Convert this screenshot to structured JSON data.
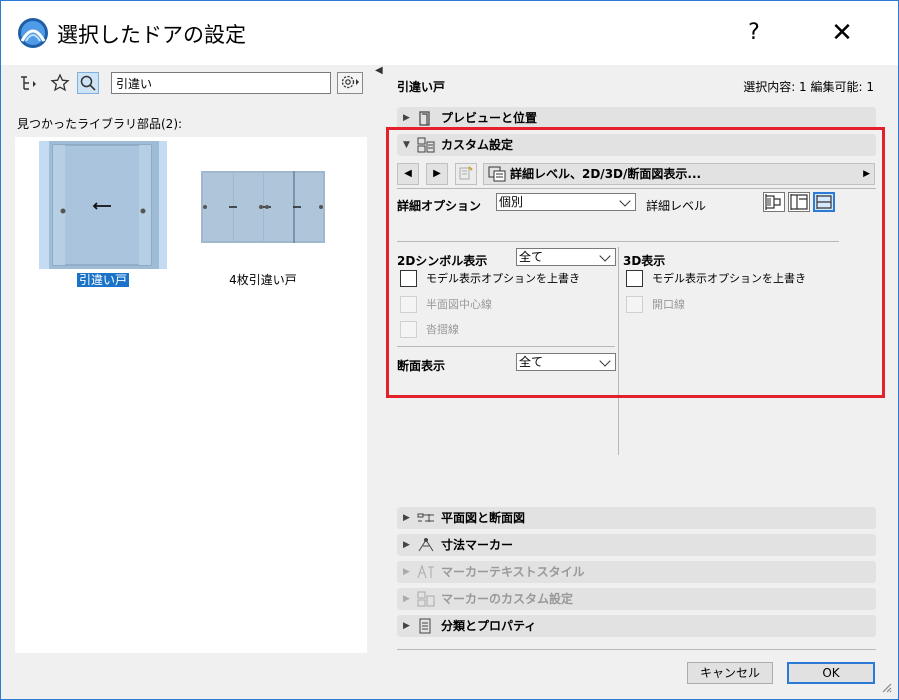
{
  "window": {
    "title": "選択したドアの設定",
    "help_glyph": "?",
    "close_glyph": "✕"
  },
  "library": {
    "search_value": "引違い",
    "found_label": "見つかったライブラリ部品(2):",
    "items": [
      {
        "label": "引違い戸",
        "selected": true
      },
      {
        "label": "4枚引違い戸",
        "selected": false
      }
    ]
  },
  "panel": {
    "title": "引違い戸",
    "selection_info": "選択内容: 1 編集可能: 1",
    "sections": {
      "preview": "プレビューと位置",
      "custom": "カスタム設定",
      "plan_section": "平面図と断面図",
      "dimension_marker": "寸法マーカー",
      "marker_text_style": "マーカーテキストスタイル",
      "marker_custom": "マーカーのカスタム設定",
      "classification": "分類とプロパティ"
    },
    "path_label": "詳細レベル、2D/3D/断面図表示..."
  },
  "custom": {
    "detail_option_label": "詳細オプション",
    "detail_option_value": "個別",
    "detail_level_label": "詳細レベル",
    "symbol2d": {
      "label": "2Dシンボル表示",
      "value": "全て",
      "model_override": "モデル表示オプションを上書き",
      "plan_centerline": "半面図中心線",
      "overlap_line": "沓摺線"
    },
    "view3d": {
      "label": "3D表示",
      "model_override": "モデル表示オプションを上書き",
      "opening_line": "開口線"
    },
    "section_display": {
      "label": "断面表示",
      "value": "全て"
    }
  },
  "buttons": {
    "cancel": "キャンセル",
    "ok": "OK"
  },
  "colors": {
    "accent": "#2b7bd6",
    "highlight": "#e4202a",
    "selected_item": "#1a73c9"
  }
}
